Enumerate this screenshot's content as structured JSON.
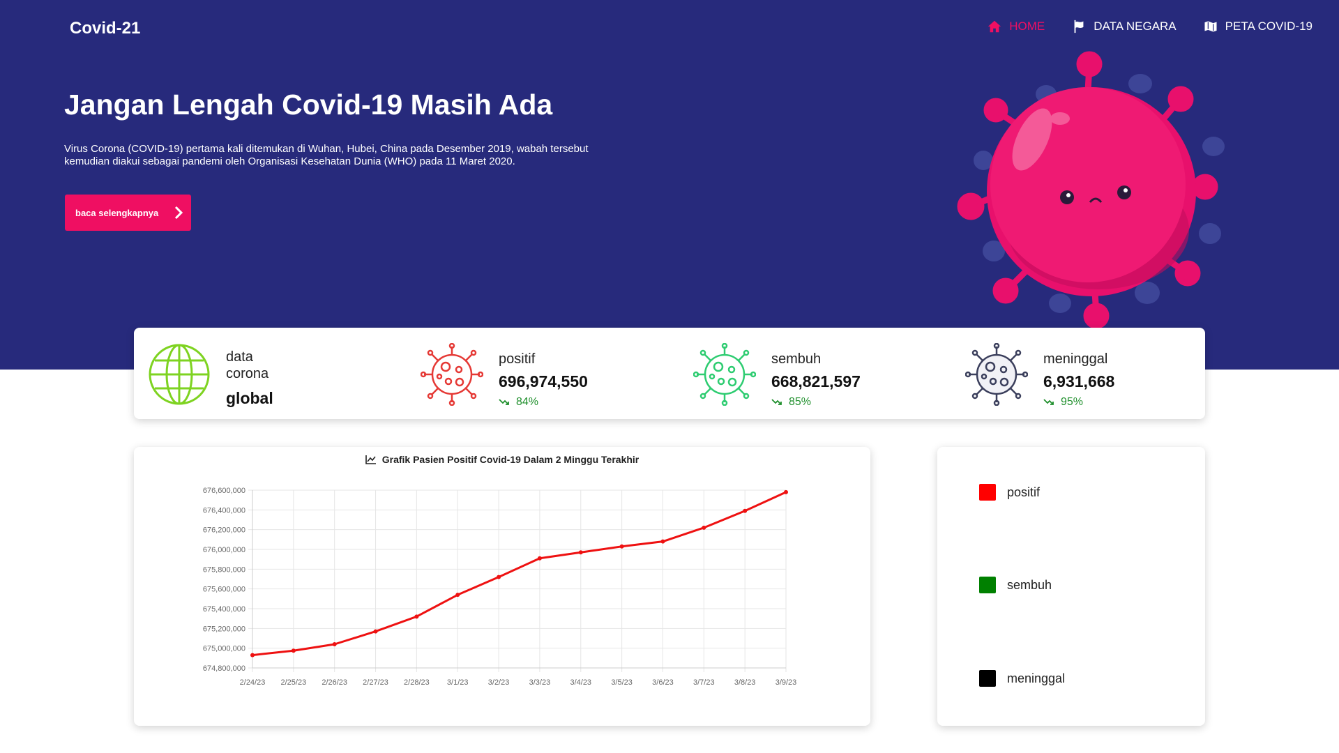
{
  "brand": "Covid-21",
  "nav": [
    {
      "label": "HOME",
      "icon": "home-icon",
      "active": true
    },
    {
      "label": "DATA NEGARA",
      "icon": "flag-icon",
      "active": false
    },
    {
      "label": "PETA COVID-19",
      "icon": "map-icon",
      "active": false
    }
  ],
  "hero": {
    "title": "Jangan Lengah Covid-19 Masih Ada",
    "description": "Virus Corona (COVID-19) pertama kali ditemukan di Wuhan, Hubei, China pada Desember 2019, wabah tersebut kemudian diakui sebagai pandemi oleh Organisasi Kesehatan Dunia (WHO) pada 11 Maret 2020.",
    "cta_label": "baca selengkapnya"
  },
  "stats": {
    "global": {
      "line1": "data",
      "line2": "corona",
      "line3": "global"
    },
    "positif": {
      "label": "positif",
      "value": "696,974,550",
      "pct": "84%",
      "color": "#e53935"
    },
    "sembuh": {
      "label": "sembuh",
      "value": "668,821,597",
      "pct": "85%",
      "color": "#2ecc71"
    },
    "meninggal": {
      "label": "meninggal",
      "value": "6,931,668",
      "pct": "95%",
      "color": "#3b3f5c"
    }
  },
  "chart_data": {
    "type": "line",
    "title": "Grafik Pasien Positif Covid-19 Dalam 2 Minggu Terakhir",
    "categories": [
      "2/24/23",
      "2/25/23",
      "2/26/23",
      "2/27/23",
      "2/28/23",
      "3/1/23",
      "3/2/23",
      "3/3/23",
      "3/4/23",
      "3/5/23",
      "3/6/23",
      "3/7/23",
      "3/8/23",
      "3/9/23"
    ],
    "series": [
      {
        "color": "#ee1111",
        "values": [
          674930000,
          674975000,
          675040000,
          675170000,
          675320000,
          675540000,
          675720000,
          675910000,
          675970000,
          676030000,
          676080000,
          676220000,
          676390000,
          676580000
        ]
      }
    ],
    "ylim": [
      674800000,
      676600000
    ],
    "yticks": [
      "676,600,000",
      "676,400,000",
      "676,200,000",
      "676,000,000",
      "675,800,000",
      "675,600,000",
      "675,400,000",
      "675,200,000",
      "675,000,000",
      "674,800,000"
    ],
    "grid": true
  },
  "legend": [
    {
      "label": "positif",
      "color": "#ff0000"
    },
    {
      "label": "sembuh",
      "color": "#008000"
    },
    {
      "label": "meninggal",
      "color": "#000000"
    }
  ]
}
